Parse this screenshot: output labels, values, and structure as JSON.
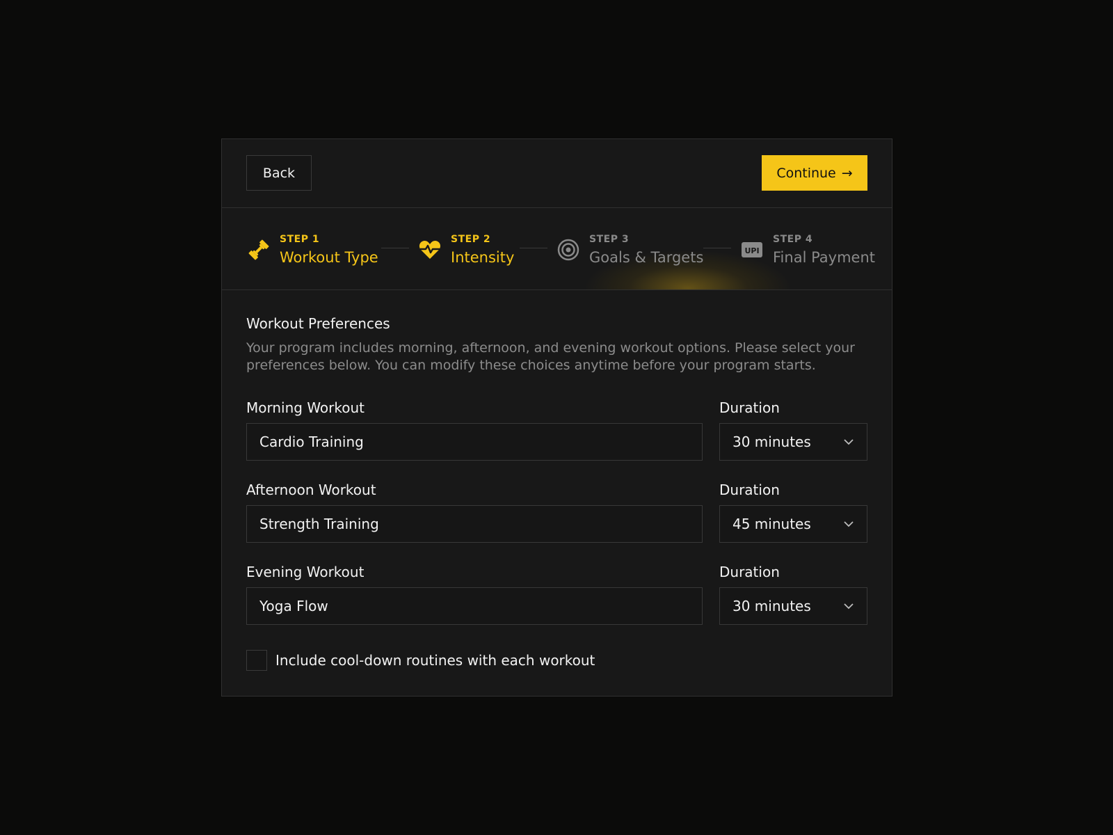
{
  "toolbar": {
    "back_label": "Back",
    "continue_label": "Continue",
    "continue_arrow": "→"
  },
  "stepper": {
    "steps": [
      {
        "kicker": "STEP 1",
        "title": "Workout Type",
        "icon": "dumbbell-icon",
        "state": "completed"
      },
      {
        "kicker": "STEP 2",
        "title": "Intensity",
        "icon": "heart-pulse-icon",
        "state": "current"
      },
      {
        "kicker": "STEP 3",
        "title": "Goals & Targets",
        "icon": "target-icon",
        "state": "upcoming"
      },
      {
        "kicker": "STEP 4",
        "title": "Final Payment",
        "icon": "upi-icon",
        "state": "upcoming"
      }
    ],
    "upi_badge_text": "UPI"
  },
  "section": {
    "title": "Workout Preferences",
    "description": "Your program includes morning, afternoon, and evening workout options. Please select your preferences below. You can modify these choices anytime before your program starts."
  },
  "workouts": [
    {
      "label": "Morning Workout",
      "value": "Cardio Training",
      "duration_label": "Duration",
      "duration": "30 minutes"
    },
    {
      "label": "Afternoon Workout",
      "value": "Strength Training",
      "duration_label": "Duration",
      "duration": "45 minutes"
    },
    {
      "label": "Evening Workout",
      "value": "Yoga Flow",
      "duration_label": "Duration",
      "duration": "30 minutes"
    }
  ],
  "cooldown": {
    "label": "Include cool-down routines with each workout",
    "checked": false
  },
  "colors": {
    "accent": "#f5c518",
    "background": "#0b0b0a",
    "card": "#181818",
    "muted_text": "#8c8c8c"
  }
}
